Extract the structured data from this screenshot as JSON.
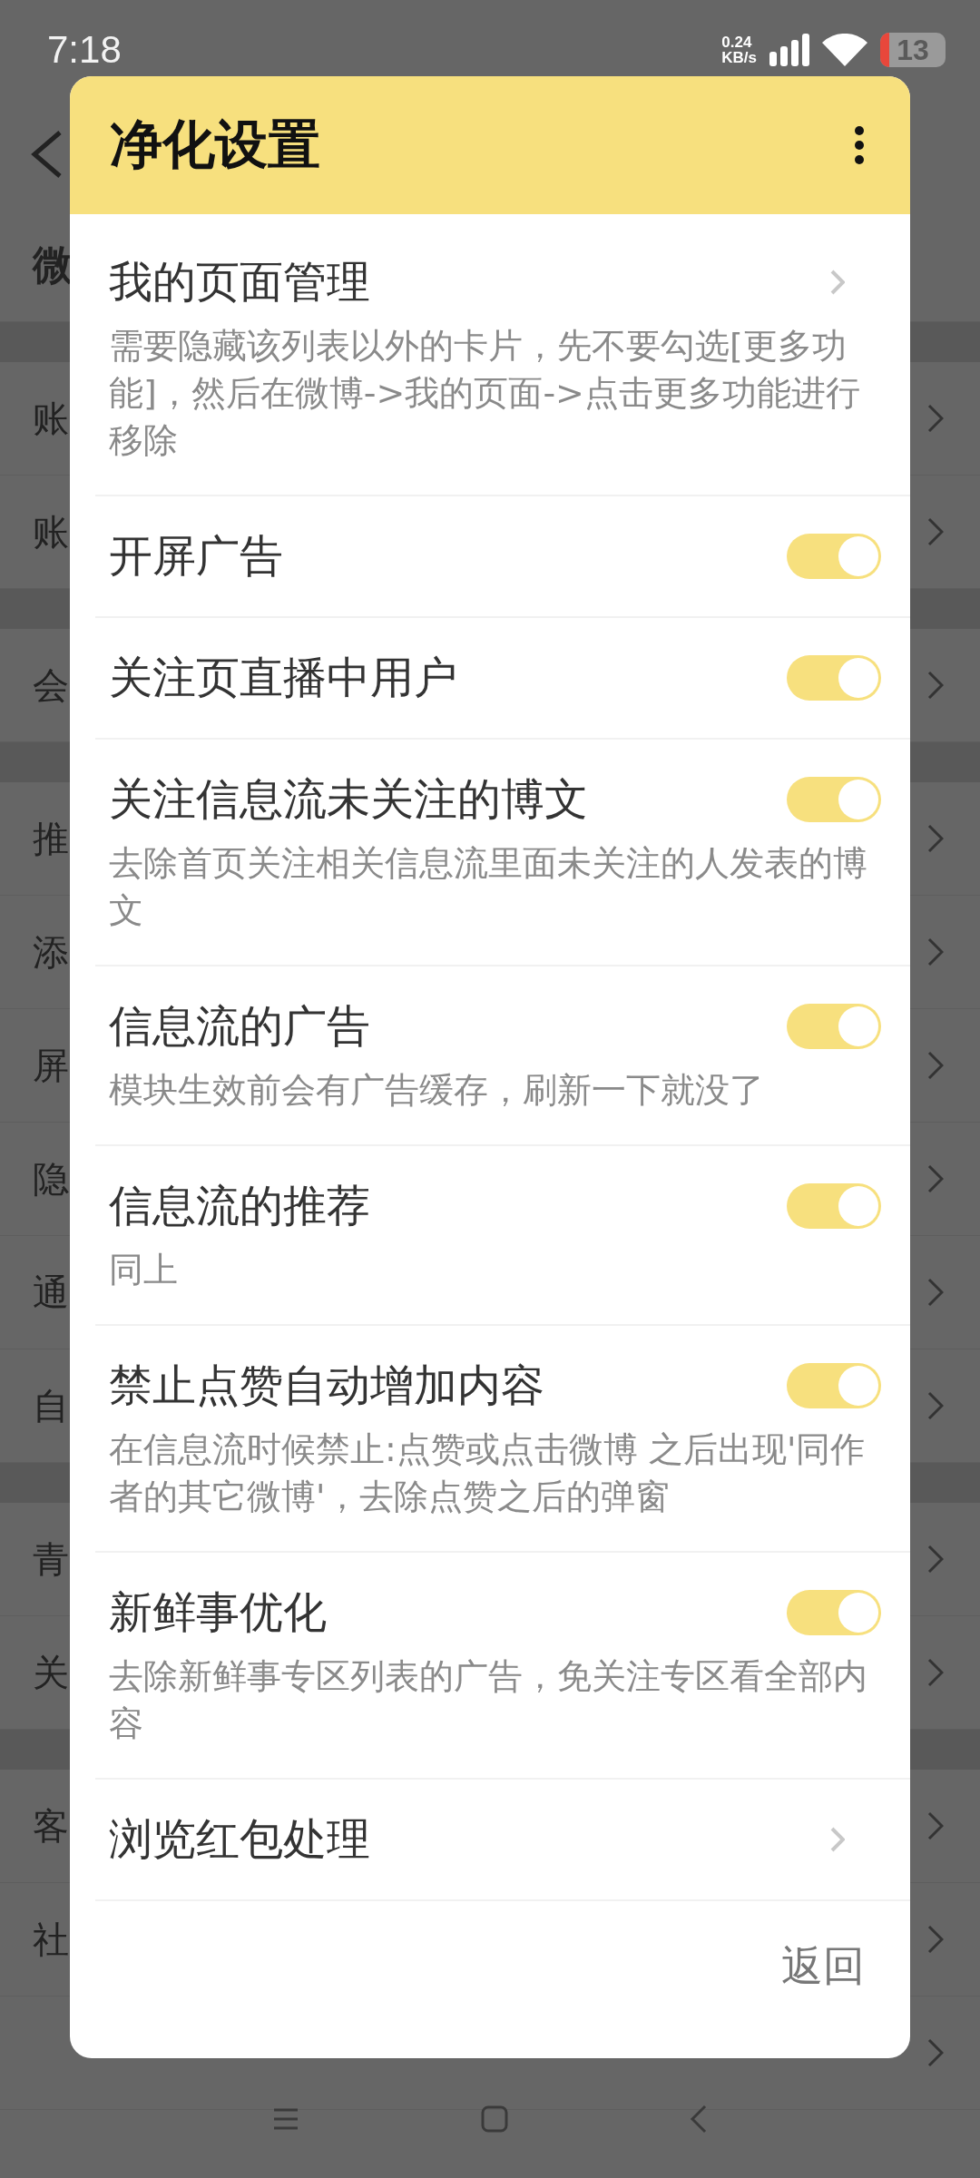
{
  "status_bar": {
    "time": "7:18",
    "net_speed_value": "0.24",
    "net_speed_unit": "KB/s",
    "battery": "13"
  },
  "background": {
    "sections": [
      {
        "rows": [
          {
            "label": "微",
            "chevron": false
          }
        ]
      },
      {
        "rows": [
          {
            "label": "账",
            "chevron": true
          },
          {
            "label": "账",
            "chevron": true
          }
        ]
      },
      {
        "rows": [
          {
            "label": "会",
            "chevron": true
          }
        ]
      },
      {
        "rows": [
          {
            "label": "推",
            "chevron": true
          },
          {
            "label": "添",
            "chevron": true
          },
          {
            "label": "屏",
            "chevron": true
          },
          {
            "label": "隐",
            "chevron": true
          },
          {
            "label": "通",
            "chevron": true
          },
          {
            "label": "自",
            "chevron": true
          }
        ]
      },
      {
        "rows": [
          {
            "label": "青",
            "chevron": true
          },
          {
            "label": "关",
            "chevron": true
          }
        ]
      },
      {
        "rows": [
          {
            "label": "客",
            "chevron": true
          },
          {
            "label": "社",
            "chevron": true
          },
          {
            "chevron": true
          }
        ]
      }
    ]
  },
  "dialog": {
    "title": "净化设置",
    "items": [
      {
        "kind": "link",
        "title": "我的页面管理",
        "description": "需要隐藏该列表以外的卡片，先不要勾选[更多功能]，然后在微博->我的页面->点击更多功能进行移除"
      },
      {
        "kind": "toggle",
        "title": "开屏广告",
        "on": true
      },
      {
        "kind": "toggle",
        "title": "关注页直播中用户",
        "on": true
      },
      {
        "kind": "toggle",
        "title": "关注信息流未关注的博文",
        "on": true,
        "description": "去除首页关注相关信息流里面未关注的人发表的博文"
      },
      {
        "kind": "toggle",
        "title": "信息流的广告",
        "on": true,
        "description": "模块生效前会有广告缓存，刷新一下就没了"
      },
      {
        "kind": "toggle",
        "title": "信息流的推荐",
        "on": true,
        "description": "同上"
      },
      {
        "kind": "toggle",
        "title": "禁止点赞自动增加内容",
        "on": true,
        "description": "在信息流时候禁止:点赞或点击微博 之后出现'同作者的其它微博'，去除点赞之后的弹窗"
      },
      {
        "kind": "toggle",
        "title": "新鲜事优化",
        "on": true,
        "description": "去除新鲜事专区列表的广告，免关注专区看全部内容"
      },
      {
        "kind": "link",
        "title": "浏览红包处理"
      }
    ],
    "footer_button": "返回"
  }
}
